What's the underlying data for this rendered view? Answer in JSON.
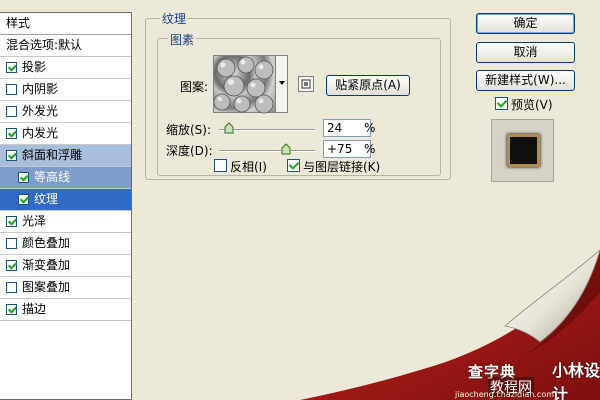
{
  "style_list": {
    "header": "样式",
    "items": [
      {
        "label": "混合选项:默认",
        "checkbox": false,
        "checked": false,
        "level": 0,
        "selected": ""
      },
      {
        "label": "投影",
        "checkbox": true,
        "checked": true,
        "level": 0,
        "selected": ""
      },
      {
        "label": "内阴影",
        "checkbox": true,
        "checked": false,
        "level": 0,
        "selected": ""
      },
      {
        "label": "外发光",
        "checkbox": true,
        "checked": false,
        "level": 0,
        "selected": ""
      },
      {
        "label": "内发光",
        "checkbox": true,
        "checked": true,
        "level": 0,
        "selected": ""
      },
      {
        "label": "斜面和浮雕",
        "checkbox": true,
        "checked": true,
        "level": 0,
        "selected": "sel1"
      },
      {
        "label": "等高线",
        "checkbox": true,
        "checked": true,
        "level": 1,
        "selected": "sel2"
      },
      {
        "label": "纹理",
        "checkbox": true,
        "checked": true,
        "level": 1,
        "selected": "sel3"
      },
      {
        "label": "光泽",
        "checkbox": true,
        "checked": true,
        "level": 0,
        "selected": ""
      },
      {
        "label": "颜色叠加",
        "checkbox": true,
        "checked": false,
        "level": 0,
        "selected": ""
      },
      {
        "label": "渐变叠加",
        "checkbox": true,
        "checked": true,
        "level": 0,
        "selected": ""
      },
      {
        "label": "图案叠加",
        "checkbox": true,
        "checked": false,
        "level": 0,
        "selected": ""
      },
      {
        "label": "描边",
        "checkbox": true,
        "checked": true,
        "level": 0,
        "selected": ""
      }
    ]
  },
  "texture": {
    "group_title": "纹理",
    "subgroup_title": "图素",
    "pattern_label": "图案:",
    "snap_origin_button": "贴紧原点(A)",
    "scale_label": "缩放(S):",
    "scale_value": "24",
    "scale_unit": "%",
    "depth_label": "深度(D):",
    "depth_value": "+75",
    "depth_unit": "%",
    "invert_label": "反相(I)",
    "invert_checked": false,
    "link_label": "与图层链接(K)",
    "link_checked": true
  },
  "actions": {
    "ok": "确定",
    "cancel": "取消",
    "new_style": "新建样式(W)...",
    "preview_label": "预览(V)",
    "preview_checked": true
  },
  "watermark": {
    "top_right": "小林设计",
    "left_line": "查字典",
    "middle_line": "教程网",
    "url": "jiaocheng.chazidian.com"
  }
}
